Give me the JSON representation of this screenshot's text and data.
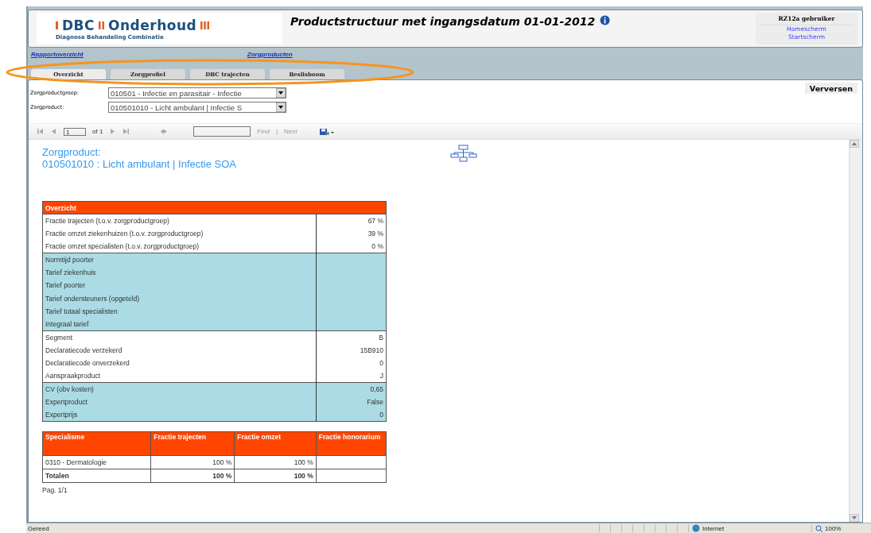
{
  "header": {
    "logo": {
      "brand_left": "DBC",
      "brand_right": "Onderhoud",
      "tagline": "Diagnose Behandeling Combinatie"
    },
    "title": "Productstructuur met ingangsdatum 01-01-2012",
    "user": {
      "name": "RZ12a gebruiker",
      "links": [
        "Homescherm",
        "Startscherm"
      ]
    }
  },
  "breadcrumb": [
    "Rapportoverzicht",
    "Zorgproducten"
  ],
  "tabs": [
    {
      "label": "Overzicht",
      "selected": true
    },
    {
      "label": "Zorgprofiel",
      "selected": false
    },
    {
      "label": "DBC trajecten",
      "selected": false
    },
    {
      "label": "Beslisboom",
      "selected": false
    }
  ],
  "parameters": [
    {
      "label": "Zorgproductgroep:",
      "value": "010501 - Infectie en parasitair - Infectie"
    },
    {
      "label": "Zorgproduct:",
      "value": "010501010 - Licht ambulant | Infectie S"
    }
  ],
  "refresh_button": "Verversen",
  "toolbar": {
    "page": "1",
    "of": "of 1",
    "find": "Find",
    "separator": "|",
    "next": "Next"
  },
  "report": {
    "heading": [
      "Zorgproduct:",
      "010501010 : Licht ambulant | Infectie SOA"
    ],
    "overview": {
      "title": "Overzicht",
      "groups": [
        {
          "shaded": false,
          "rows": [
            [
              "Fractie trajecten (t.o.v. zorgproductgroep)",
              "67 %"
            ],
            [
              "Fractie omzet ziekenhuizen (t.o.v. zorgproductgroep)",
              "39 %"
            ],
            [
              "Fractie omzet specialisten (t.o.v. zorgproductgroep)",
              "0 %"
            ]
          ]
        },
        {
          "shaded": true,
          "rows": [
            [
              "Normtijd poorter",
              ""
            ],
            [
              "Tarief ziekenhuis",
              ""
            ],
            [
              "Tarief poorter",
              ""
            ],
            [
              "Tarief ondersteuners (opgeteld)",
              ""
            ],
            [
              "Tarief totaal specialisten",
              ""
            ],
            [
              "Integraal tarief",
              ""
            ]
          ]
        },
        {
          "shaded": false,
          "rows": [
            [
              "Segment",
              "B"
            ],
            [
              "Declaratiecode verzekerd",
              "15B910"
            ],
            [
              "Declaratiecode onverzekerd",
              "0"
            ],
            [
              "Aanspraakproduct",
              "J"
            ]
          ]
        },
        {
          "shaded": true,
          "rows": [
            [
              "CV (obv kosten)",
              "0,65"
            ],
            [
              "Expertproduct",
              "False"
            ],
            [
              "Expertprijs",
              "0"
            ]
          ]
        }
      ]
    },
    "specialism_table": {
      "columns": [
        "Specialisme",
        "Fractie trajecten",
        "Fractie omzet",
        "Fractie honorarium"
      ],
      "rows": [
        {
          "kind": "normal",
          "cells": [
            "0310 - Dermatologie",
            "100 %",
            "100 %",
            ""
          ]
        },
        {
          "kind": "total",
          "cells": [
            "Totalen",
            "100 %",
            "100 %",
            ""
          ]
        }
      ]
    },
    "page_footer": "Pag. 1/1"
  },
  "status_bar": {
    "status": "Gereed",
    "zone": "Internet",
    "zoom": "100%"
  }
}
